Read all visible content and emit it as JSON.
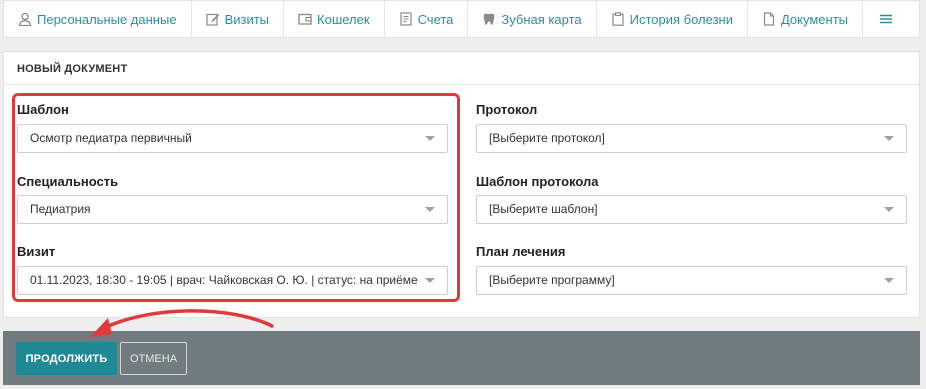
{
  "tabs": [
    {
      "label": "Персональные данные",
      "icon": "user-icon"
    },
    {
      "label": "Визиты",
      "icon": "edit-icon"
    },
    {
      "label": "Кошелек",
      "icon": "wallet-icon"
    },
    {
      "label": "Счета",
      "icon": "invoice-icon"
    },
    {
      "label": "Зубная карта",
      "icon": "tooth-icon"
    },
    {
      "label": "История болезни",
      "icon": "clipboard-icon"
    },
    {
      "label": "Документы",
      "icon": "document-icon"
    },
    {
      "label": "",
      "icon": "menu-icon"
    }
  ],
  "card": {
    "title": "НОВЫЙ ДОКУМЕНТ"
  },
  "left_fields": {
    "template": {
      "label": "Шаблон",
      "value": "Осмотр педиатра первичный"
    },
    "specialty": {
      "label": "Специальность",
      "value": "Педиатрия"
    },
    "visit": {
      "label": "Визит",
      "value": "01.11.2023, 18:30 - 19:05 | врач: Чайковская О. Ю. | статус: на приёме"
    }
  },
  "right_fields": {
    "protocol": {
      "label": "Протокол",
      "value": "[Выберите протокол]"
    },
    "protocol_template": {
      "label": "Шаблон протокола",
      "value": "[Выберите шаблон]"
    },
    "treatment_plan": {
      "label": "План лечения",
      "value": "[Выберите программу]"
    }
  },
  "footer": {
    "continue_label": "ПРОДОЛЖИТЬ",
    "cancel_label": "ОТМЕНА"
  },
  "colors": {
    "accent": "#1f8a96",
    "link": "#2a8fa0",
    "highlight": "#e03a3a",
    "footer_bg": "#707c80"
  }
}
